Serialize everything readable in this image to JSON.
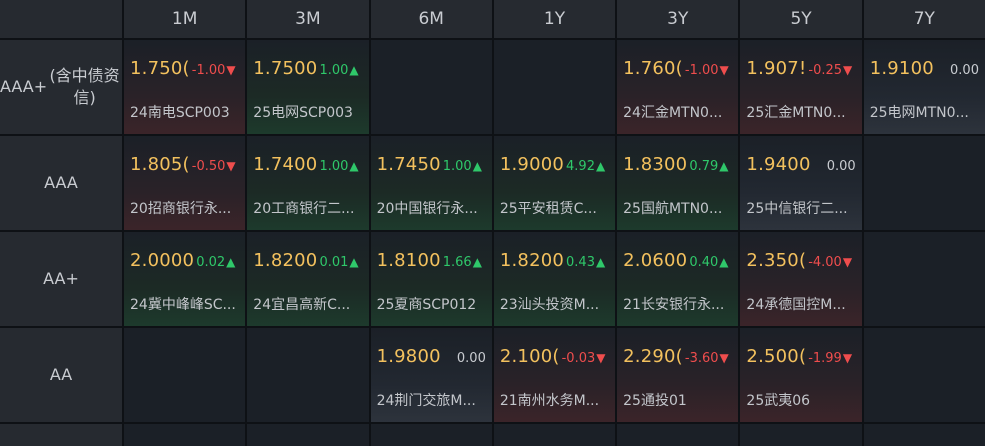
{
  "columns": [
    "1M",
    "3M",
    "6M",
    "1Y",
    "3Y",
    "5Y",
    "7Y"
  ],
  "rows": [
    {
      "label_lines": [
        "AAA+",
        "(含中债资信)"
      ],
      "cells": [
        {
          "price": "1.750(",
          "delta": "-1.00",
          "dir": "down",
          "bond": "24南电SCP003"
        },
        {
          "price": "1.7500",
          "delta": "1.00",
          "dir": "up",
          "bond": "25电网SCP003"
        },
        null,
        null,
        {
          "price": "1.760(",
          "delta": "-1.00",
          "dir": "down",
          "bond": "24汇金MTN0..."
        },
        {
          "price": "1.907!",
          "delta": "-0.25",
          "dir": "down",
          "bond": "25汇金MTN0..."
        },
        {
          "price": "1.9100",
          "delta": "0.00",
          "dir": "flat",
          "bond": "25电网MTN0..."
        }
      ]
    },
    {
      "label_lines": [
        "AAA"
      ],
      "cells": [
        {
          "price": "1.805(",
          "delta": "-0.50",
          "dir": "down",
          "bond": "20招商银行永..."
        },
        {
          "price": "1.7400",
          "delta": "1.00",
          "dir": "up",
          "bond": "20工商银行二..."
        },
        {
          "price": "1.7450",
          "delta": "1.00",
          "dir": "up",
          "bond": "20中国银行永..."
        },
        {
          "price": "1.9000",
          "delta": "4.92",
          "dir": "up",
          "bond": "25平安租赁C..."
        },
        {
          "price": "1.8300",
          "delta": "0.79",
          "dir": "up",
          "bond": "25国航MTN0..."
        },
        {
          "price": "1.9400",
          "delta": "0.00",
          "dir": "flat",
          "bond": "25中信银行二..."
        },
        null
      ]
    },
    {
      "label_lines": [
        "AA+"
      ],
      "cells": [
        {
          "price": "2.0000",
          "delta": "0.02",
          "dir": "up",
          "bond": "24冀中峰峰SC..."
        },
        {
          "price": "1.8200",
          "delta": "0.01",
          "dir": "up",
          "bond": "24宜昌高新C..."
        },
        {
          "price": "1.8100",
          "delta": "1.66",
          "dir": "up",
          "bond": "25夏商SCP012"
        },
        {
          "price": "1.8200",
          "delta": "0.43",
          "dir": "up",
          "bond": "23汕头投资M..."
        },
        {
          "price": "2.0600",
          "delta": "0.40",
          "dir": "up",
          "bond": "21长安银行永..."
        },
        {
          "price": "2.350(",
          "delta": "-4.00",
          "dir": "down",
          "bond": "24承德国控M..."
        },
        null
      ]
    },
    {
      "label_lines": [
        "AA"
      ],
      "cells": [
        null,
        null,
        {
          "price": "1.9800",
          "delta": "0.00",
          "dir": "flat",
          "bond": "24荆门交旅M..."
        },
        {
          "price": "2.100(",
          "delta": "-0.03",
          "dir": "down",
          "bond": "21南州水务M..."
        },
        {
          "price": "2.290(",
          "delta": "-3.60",
          "dir": "down",
          "bond": "25通投01"
        },
        {
          "price": "2.500(",
          "delta": "-1.99",
          "dir": "down",
          "bond": "25武夷06"
        },
        null
      ]
    }
  ],
  "icons": {
    "up": "triangle-up-icon",
    "down": "triangle-down-icon"
  },
  "colors": {
    "price": "#f3c15e",
    "up": "#2fc86a",
    "down": "#ef4d4d",
    "flat": "#c9ccd1"
  }
}
